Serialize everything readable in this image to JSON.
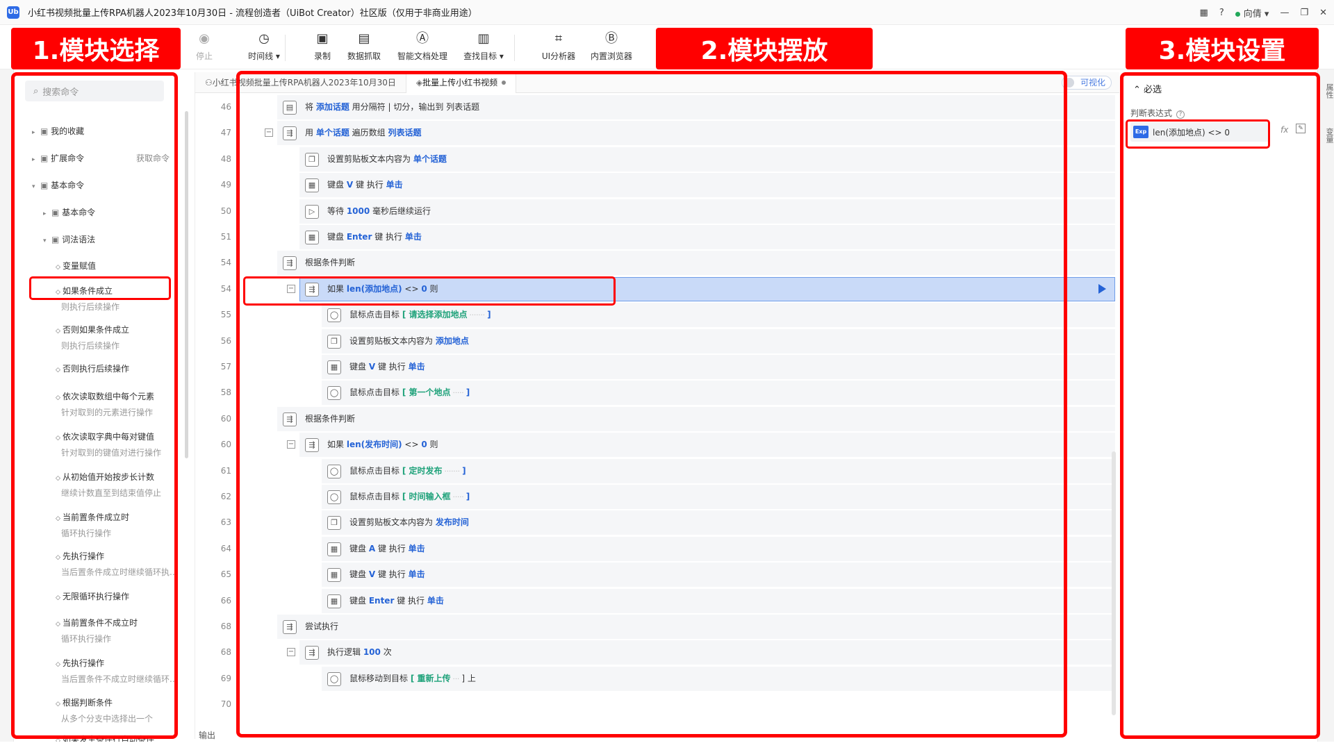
{
  "window": {
    "title": "小红书视频批量上传RPA机器人2023年10月30日 - 流程创造者（UiBot Creator）社区版（仅用于非商业用途）",
    "logo_text": "Ub",
    "user": "向倩",
    "help": "?"
  },
  "toolbar": [
    {
      "label": "停止",
      "icon": "stop-icon",
      "glyph": "◉"
    },
    {
      "label": "时间线 ▾",
      "icon": "clock-icon",
      "glyph": "◷"
    },
    {
      "label": "录制",
      "icon": "record-icon",
      "glyph": "▣"
    },
    {
      "label": "数据抓取",
      "icon": "data-scrape-icon",
      "glyph": "▤"
    },
    {
      "label": "智能文档处理",
      "icon": "ai-doc-icon",
      "glyph": "Ⓐ"
    },
    {
      "label": "查找目标 ▾",
      "icon": "find-target-icon",
      "glyph": "▥"
    },
    {
      "label": "UI分析器",
      "icon": "ui-analyzer-icon",
      "glyph": "⌗"
    },
    {
      "label": "内置浏览器",
      "icon": "browser-icon",
      "glyph": "Ⓑ"
    }
  ],
  "sidebar": {
    "search_placeholder": "搜索命令",
    "get_commands": "获取命令",
    "items": [
      {
        "label": "我的收藏",
        "caret": "▸"
      },
      {
        "label": "扩展命令",
        "caret": "▸"
      },
      {
        "label": "基本命令",
        "caret": "▾"
      },
      {
        "label": "基本命令",
        "caret": "▸"
      },
      {
        "label": "词法语法",
        "caret": "▾"
      },
      {
        "label": "变量赋值",
        "sub": ""
      },
      {
        "label": "如果条件成立",
        "sub": "则执行后续操作"
      },
      {
        "label": "否则如果条件成立",
        "sub": "则执行后续操作"
      },
      {
        "label": "否则执行后续操作",
        "sub": ""
      },
      {
        "label": "依次读取数组中每个元素",
        "sub": "针对取到的元素进行操作"
      },
      {
        "label": "依次读取字典中每对键值",
        "sub": "针对取到的键值对进行操作"
      },
      {
        "label": "从初始值开始按步长计数",
        "sub": "继续计数直至到结束值停止"
      },
      {
        "label": "当前置条件成立时",
        "sub": "循环执行操作"
      },
      {
        "label": "先执行操作",
        "sub": "当后置条件成立时继续循环执..."
      },
      {
        "label": "无限循环执行操作",
        "sub": ""
      },
      {
        "label": "当前置条件不成立时",
        "sub": "循环执行操作"
      },
      {
        "label": "先执行操作",
        "sub": "当后置条件不成立时继续循环..."
      },
      {
        "label": "根据判断条件",
        "sub": "从多个分支中选择出一个"
      },
      {
        "label": "如果发生条件行自动条件",
        "sub": ""
      }
    ]
  },
  "editor": {
    "tabs": [
      {
        "label": "小红书视频批量上传RPA机器人2023年10月30日"
      },
      {
        "label": "批量上传小红书视频"
      }
    ],
    "visual_toggle": "可视化",
    "output_label": "输出",
    "rows": [
      {
        "ln": "46",
        "indent": 0,
        "icon": "▤",
        "parts": [
          [
            "将 ",
            ""
          ],
          [
            "添加话题",
            "blue"
          ],
          [
            " 用分隔符 | 切分，输出到 列表话题",
            ""
          ]
        ]
      },
      {
        "ln": "47",
        "indent": 0,
        "collapse": true,
        "icon": "⇶",
        "parts": [
          [
            "用 ",
            ""
          ],
          [
            "单个话题",
            "blue"
          ],
          [
            " 遍历数组 ",
            ""
          ],
          [
            "列表话题",
            "blue"
          ]
        ]
      },
      {
        "ln": "48",
        "indent": 1,
        "icon": "❐",
        "parts": [
          [
            "设置剪贴板文本内容为 ",
            ""
          ],
          [
            "单个话题",
            "blue"
          ]
        ]
      },
      {
        "ln": "49",
        "indent": 1,
        "icon": "▦",
        "parts": [
          [
            "键盘 ",
            ""
          ],
          [
            "V",
            "blue"
          ],
          [
            " 键 执行 ",
            ""
          ],
          [
            "单击",
            "blue"
          ]
        ]
      },
      {
        "ln": "50",
        "indent": 1,
        "icon": "▷",
        "parts": [
          [
            "等待 ",
            ""
          ],
          [
            "1000",
            "blue"
          ],
          [
            " 毫秒后继续运行",
            ""
          ]
        ]
      },
      {
        "ln": "51",
        "indent": 1,
        "icon": "▦",
        "parts": [
          [
            "键盘 ",
            ""
          ],
          [
            "Enter",
            "blue"
          ],
          [
            " 键 执行 ",
            ""
          ],
          [
            "单击",
            "blue"
          ]
        ]
      },
      {
        "ln": "54",
        "indent": 0,
        "icon": "⇶",
        "parts": [
          [
            "根据条件判断",
            ""
          ]
        ]
      },
      {
        "ln": "54",
        "indent": 1,
        "collapse": true,
        "icon": "⇶",
        "selected": true,
        "play": true,
        "parts": [
          [
            "如果 ",
            ""
          ],
          [
            "len(添加地点)",
            "blue"
          ],
          [
            " <> ",
            ""
          ],
          [
            "0",
            "blue"
          ],
          [
            " 则",
            ""
          ]
        ]
      },
      {
        "ln": "55",
        "indent": 2,
        "icon": "◯",
        "parts": [
          [
            "鼠标点击目标 ",
            ""
          ],
          [
            "[ 请选择添加地点",
            "green"
          ],
          [
            "  ·······  ",
            "faint"
          ],
          [
            "]",
            "blue"
          ]
        ]
      },
      {
        "ln": "56",
        "indent": 2,
        "icon": "❐",
        "parts": [
          [
            "设置剪贴板文本内容为 ",
            ""
          ],
          [
            "添加地点",
            "blue"
          ]
        ]
      },
      {
        "ln": "57",
        "indent": 2,
        "icon": "▦",
        "parts": [
          [
            "键盘 ",
            ""
          ],
          [
            "V",
            "blue"
          ],
          [
            " 键 执行 ",
            ""
          ],
          [
            "单击",
            "blue"
          ]
        ]
      },
      {
        "ln": "58",
        "indent": 2,
        "icon": "◯",
        "parts": [
          [
            "鼠标点击目标 ",
            ""
          ],
          [
            "[ 第一个地点",
            "green"
          ],
          [
            "  ·····  ",
            "faint"
          ],
          [
            "]",
            "blue"
          ]
        ]
      },
      {
        "ln": "60",
        "indent": 0,
        "icon": "⇶",
        "parts": [
          [
            "根据条件判断",
            ""
          ]
        ]
      },
      {
        "ln": "60",
        "indent": 1,
        "collapse": true,
        "icon": "⇶",
        "parts": [
          [
            "如果 ",
            ""
          ],
          [
            "len(发布时间)",
            "blue"
          ],
          [
            " <> ",
            ""
          ],
          [
            "0",
            "blue"
          ],
          [
            " 则",
            ""
          ]
        ]
      },
      {
        "ln": "61",
        "indent": 2,
        "icon": "◯",
        "parts": [
          [
            "鼠标点击目标 ",
            ""
          ],
          [
            "[ 定时发布",
            "green"
          ],
          [
            "  ·······  ",
            "faint"
          ],
          [
            "]",
            "blue"
          ]
        ]
      },
      {
        "ln": "62",
        "indent": 2,
        "icon": "◯",
        "parts": [
          [
            "鼠标点击目标 ",
            ""
          ],
          [
            "[ 时间输入框",
            "green"
          ],
          [
            "  ·····  ",
            "faint"
          ],
          [
            "]",
            "blue"
          ]
        ]
      },
      {
        "ln": "63",
        "indent": 2,
        "icon": "❐",
        "parts": [
          [
            "设置剪贴板文本内容为 ",
            ""
          ],
          [
            "发布时间",
            "blue"
          ]
        ]
      },
      {
        "ln": "64",
        "indent": 2,
        "icon": "▦",
        "parts": [
          [
            "键盘 ",
            ""
          ],
          [
            "A",
            "blue"
          ],
          [
            " 键 执行 ",
            ""
          ],
          [
            "单击",
            "blue"
          ]
        ]
      },
      {
        "ln": "65",
        "indent": 2,
        "icon": "▦",
        "parts": [
          [
            "键盘 ",
            ""
          ],
          [
            "V",
            "blue"
          ],
          [
            " 键 执行 ",
            ""
          ],
          [
            "单击",
            "blue"
          ]
        ]
      },
      {
        "ln": "66",
        "indent": 2,
        "icon": "▦",
        "parts": [
          [
            "键盘 ",
            ""
          ],
          [
            "Enter",
            "blue"
          ],
          [
            " 键 执行 ",
            ""
          ],
          [
            "单击",
            "blue"
          ]
        ]
      },
      {
        "ln": "68",
        "indent": 0,
        "icon": "⇶",
        "parts": [
          [
            "尝试执行",
            ""
          ]
        ]
      },
      {
        "ln": "68",
        "indent": 1,
        "collapse": true,
        "icon": "⇶",
        "parts": [
          [
            "执行逻辑 ",
            ""
          ],
          [
            "100",
            "blue"
          ],
          [
            " 次",
            ""
          ]
        ]
      },
      {
        "ln": "69",
        "indent": 2,
        "icon": "◯",
        "parts": [
          [
            "鼠标移动到目标 ",
            ""
          ],
          [
            "[ 重新上传",
            "green"
          ],
          [
            "  ···  ",
            "faint"
          ],
          [
            "] 上",
            ""
          ]
        ]
      },
      {
        "ln": "70",
        "indent": 0,
        "icon": "",
        "parts": []
      }
    ]
  },
  "properties": {
    "section": "必选",
    "expression_label": "判断表达式",
    "expression_value": "len(添加地点) <> 0",
    "exp_badge": "Exp",
    "fx": "fx",
    "right_strip": [
      "属性",
      "变量"
    ]
  },
  "annotations": {
    "banner1": "1.模块选择",
    "banner2": "2.模块摆放",
    "banner3": "3.模块设置",
    "color": "#ff0000"
  }
}
